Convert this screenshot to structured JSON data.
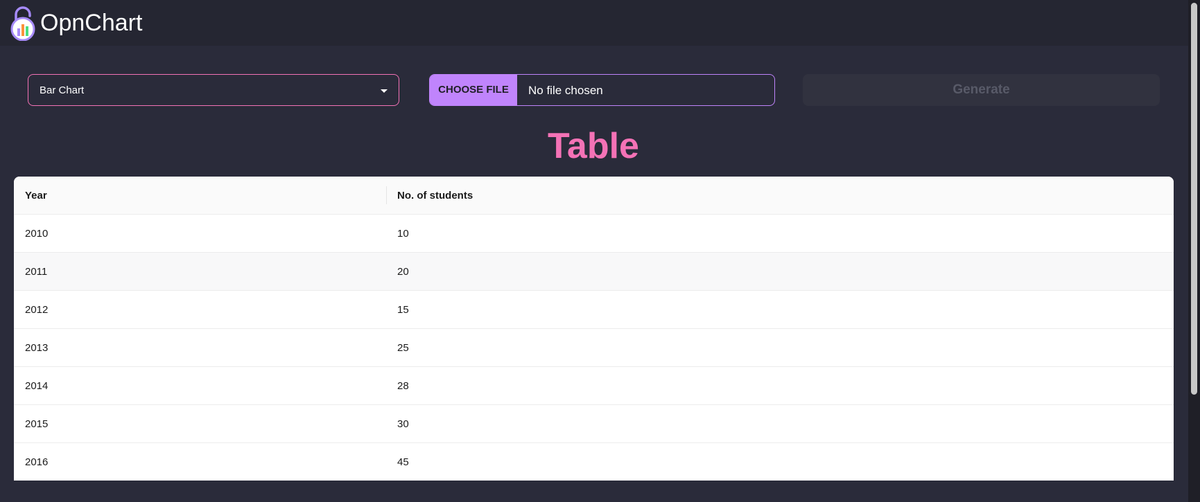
{
  "app": {
    "name": "OpnChart"
  },
  "controls": {
    "chart_type": "Bar Chart",
    "choose_file_label": "CHOOSE FILE",
    "file_status": "No file chosen",
    "generate_label": "Generate"
  },
  "section": {
    "title": "Table"
  },
  "table": {
    "columns": [
      "Year",
      "No. of students"
    ],
    "rows": [
      [
        "2010",
        "10"
      ],
      [
        "2011",
        "20"
      ],
      [
        "2012",
        "15"
      ],
      [
        "2013",
        "25"
      ],
      [
        "2014",
        "28"
      ],
      [
        "2015",
        "30"
      ],
      [
        "2016",
        "45"
      ]
    ]
  },
  "colors": {
    "background": "#2a2b3a",
    "topbar": "#252632",
    "accent_pink": "#f472b6",
    "accent_purple": "#c084fc"
  },
  "icons": {
    "logo": "open-padlock-chart-logo"
  }
}
